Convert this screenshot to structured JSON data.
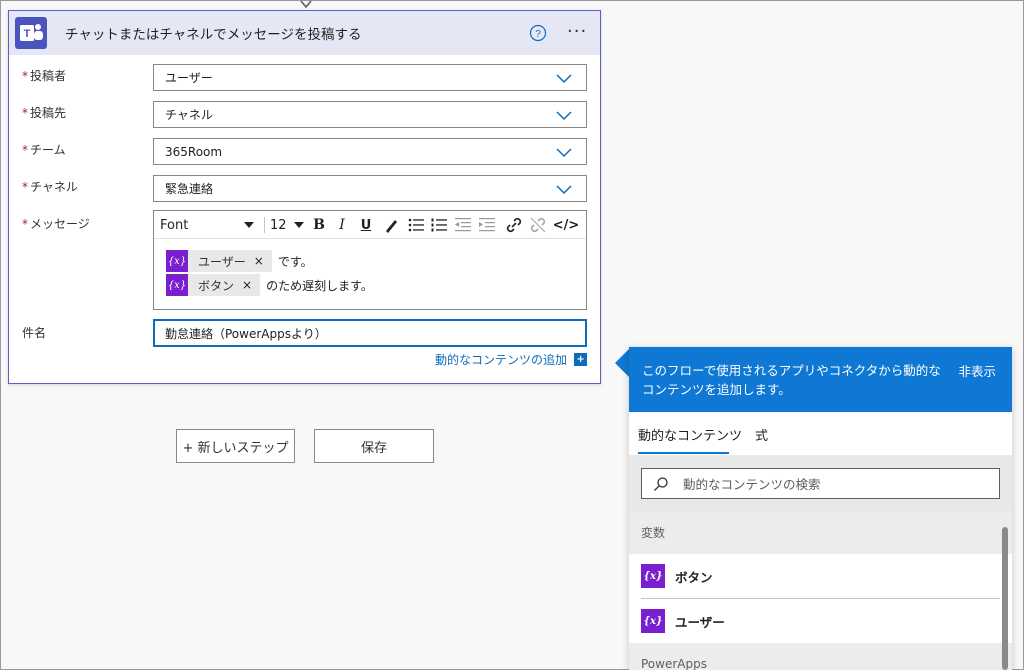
{
  "card": {
    "title": "チャットまたはチャネルでメッセージを投稿する",
    "more_label": "···"
  },
  "fields": {
    "poster": {
      "label": "投稿者",
      "value": "ユーザー"
    },
    "post_in": {
      "label": "投稿先",
      "value": "チャネル"
    },
    "team": {
      "label": "チーム",
      "value": "365Room"
    },
    "channel": {
      "label": "チャネル",
      "value": "緊急連絡"
    },
    "message": {
      "label": "メッセージ"
    },
    "subject": {
      "label": "件名",
      "value": "勤怠連絡（PowerAppsより）"
    },
    "required_mark": "*"
  },
  "editor": {
    "font": "Font",
    "size": "12",
    "bold": "B",
    "italic": "I",
    "underline": "U",
    "code": "</>",
    "tokens": [
      {
        "icon_text": "{x}",
        "label": "ユーザー",
        "remove": "×",
        "after": "です。"
      },
      {
        "icon_text": "{x}",
        "label": "ボタン",
        "remove": "×",
        "after": "のため遅刻します。"
      }
    ]
  },
  "dynamic_link": {
    "label": "動的なコンテンツの追加",
    "icon_text": "+"
  },
  "buttons": {
    "new_step": "+ 新しいステップ",
    "save": "保存"
  },
  "panel": {
    "description": "このフローで使用されるアプリやコネクタから動的なコンテンツを追加します。",
    "hide": "非表示",
    "tabs": [
      "動的なコンテンツ",
      "式"
    ],
    "search_placeholder": "動的なコンテンツの検索",
    "section_variables": "変数",
    "items": [
      {
        "icon_text": "{x}",
        "label": "ボタン"
      },
      {
        "icon_text": "{x}",
        "label": "ユーザー"
      }
    ],
    "section_powerapps": "PowerApps"
  },
  "colors": {
    "accent": "#0f78d4",
    "card_border": "#5b5fc7",
    "variable_token": "#7a1fcf",
    "required": "#a4262c"
  }
}
